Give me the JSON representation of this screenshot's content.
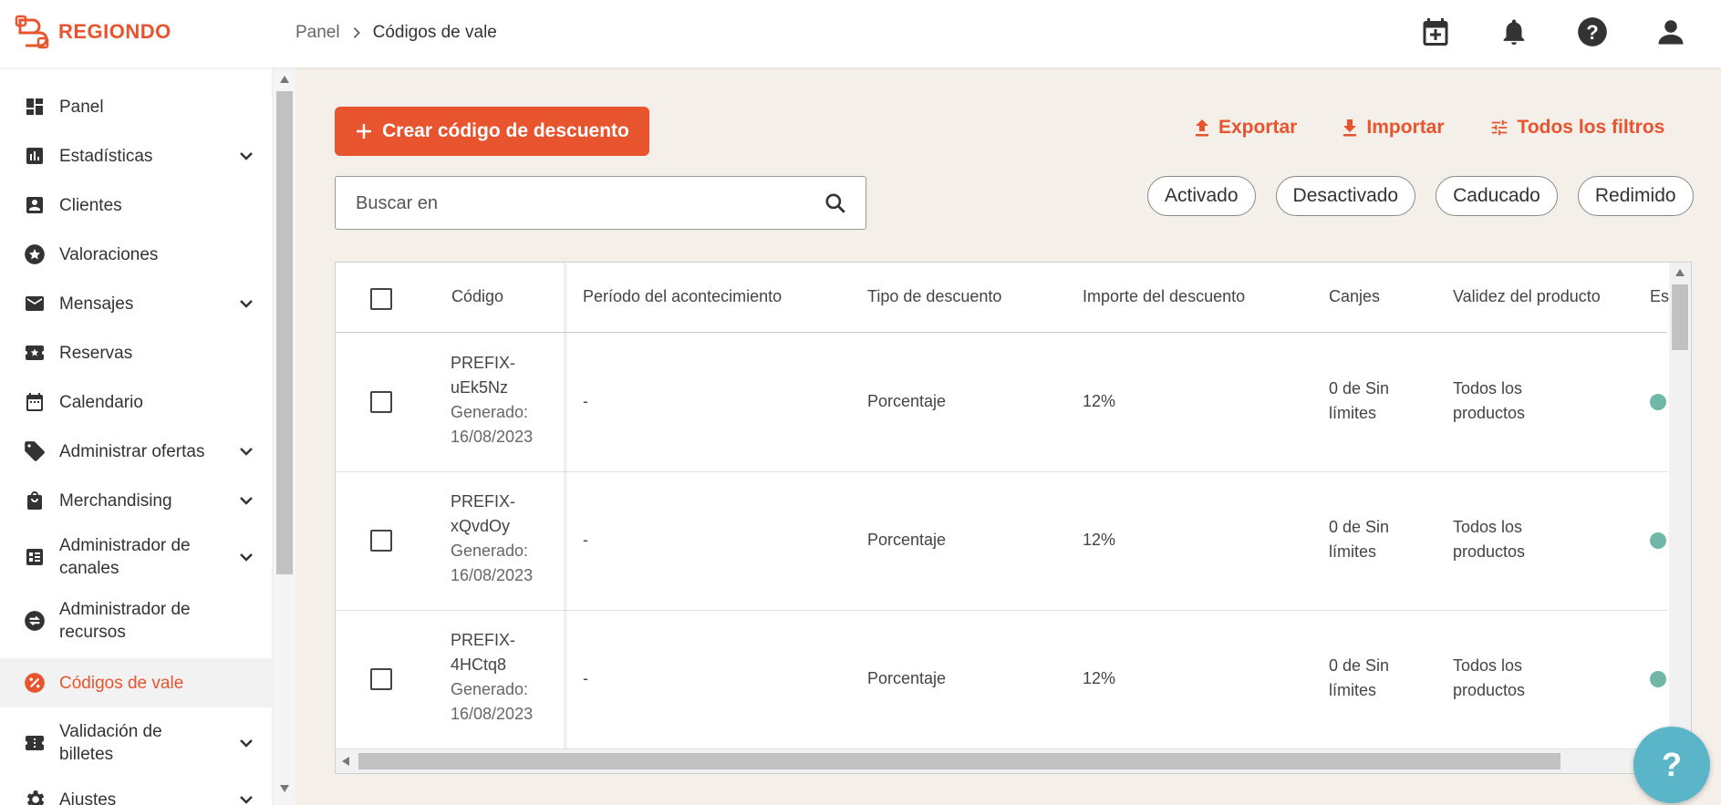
{
  "app": {
    "logo_text": "REGIONDO"
  },
  "breadcrumb": {
    "parent": "Panel",
    "current": "Códigos de vale"
  },
  "header_icons": [
    "calendar-plus-icon",
    "bell-icon",
    "help-icon",
    "user-icon"
  ],
  "sidebar": {
    "items": [
      {
        "label": "Panel",
        "icon": "dashboard-icon"
      },
      {
        "label": "Estadísticas",
        "icon": "bar-chart-icon",
        "expandable": true
      },
      {
        "label": "Clientes",
        "icon": "contact-icon"
      },
      {
        "label": "Valoraciones",
        "icon": "star-circle-icon"
      },
      {
        "label": "Mensajes",
        "icon": "mail-icon",
        "expandable": true
      },
      {
        "label": "Reservas",
        "icon": "ticket-star-icon"
      },
      {
        "label": "Calendario",
        "icon": "calendar-icon"
      },
      {
        "label": "Administrar ofertas",
        "icon": "tag-icon",
        "expandable": true
      },
      {
        "label": "Merchandising",
        "icon": "shopping-bag-icon",
        "expandable": true
      },
      {
        "label_line1": "Administrador de",
        "label_line2": "canales",
        "icon": "channels-icon",
        "expandable": true
      },
      {
        "label_line1": "Administrador de",
        "label_line2": "recursos",
        "icon": "swap-circle-icon"
      },
      {
        "label": "Códigos de vale",
        "icon": "percent-circle-icon",
        "active": true
      },
      {
        "label_line1": "Validación de",
        "label_line2": "billetes",
        "icon": "ticket-icon",
        "expandable": true
      },
      {
        "label": "Ajustes",
        "icon": "gear-icon",
        "expandable": true
      }
    ]
  },
  "toolbar": {
    "create_label": "Crear código de descuento",
    "export_label": "Exportar",
    "import_label": "Importar",
    "filters_label": "Todos los filtros"
  },
  "search": {
    "placeholder": "Buscar en",
    "value": ""
  },
  "chips": [
    "Activado",
    "Desactivado",
    "Caducado",
    "Redimido"
  ],
  "table": {
    "columns": [
      "Código",
      "Período del acontecimiento",
      "Tipo de descuento",
      "Importe del descuento",
      "Canjes",
      "Validez del producto",
      "Es"
    ],
    "rows": [
      {
        "code_line1": "PREFIX-",
        "code_line2": "uEk5Nz",
        "generated_label": "Generado:",
        "generated_date": "16/08/2023",
        "period": "-",
        "type": "Porcentaje",
        "amount": "12%",
        "redemptions_line1": "0 de Sin",
        "redemptions_line2": "límites",
        "validity_line1": "Todos los",
        "validity_line2": "productos"
      },
      {
        "code_line1": "PREFIX-",
        "code_line2": "xQvdOy",
        "generated_label": "Generado:",
        "generated_date": "16/08/2023",
        "period": "-",
        "type": "Porcentaje",
        "amount": "12%",
        "redemptions_line1": "0 de Sin",
        "redemptions_line2": "límites",
        "validity_line1": "Todos los",
        "validity_line2": "productos"
      },
      {
        "code_line1": "PREFIX-",
        "code_line2": "4HCtq8",
        "generated_label": "Generado:",
        "generated_date": "16/08/2023",
        "period": "-",
        "type": "Porcentaje",
        "amount": "12%",
        "redemptions_line1": "0 de Sin",
        "redemptions_line2": "límites",
        "validity_line1": "Todos los",
        "validity_line2": "productos"
      }
    ]
  },
  "help_fab": {
    "label": "?"
  },
  "colors": {
    "accent": "#e8542d",
    "status_active": "#6fb8a7",
    "fab": "#5bb5c9",
    "background": "#f4efe9"
  }
}
